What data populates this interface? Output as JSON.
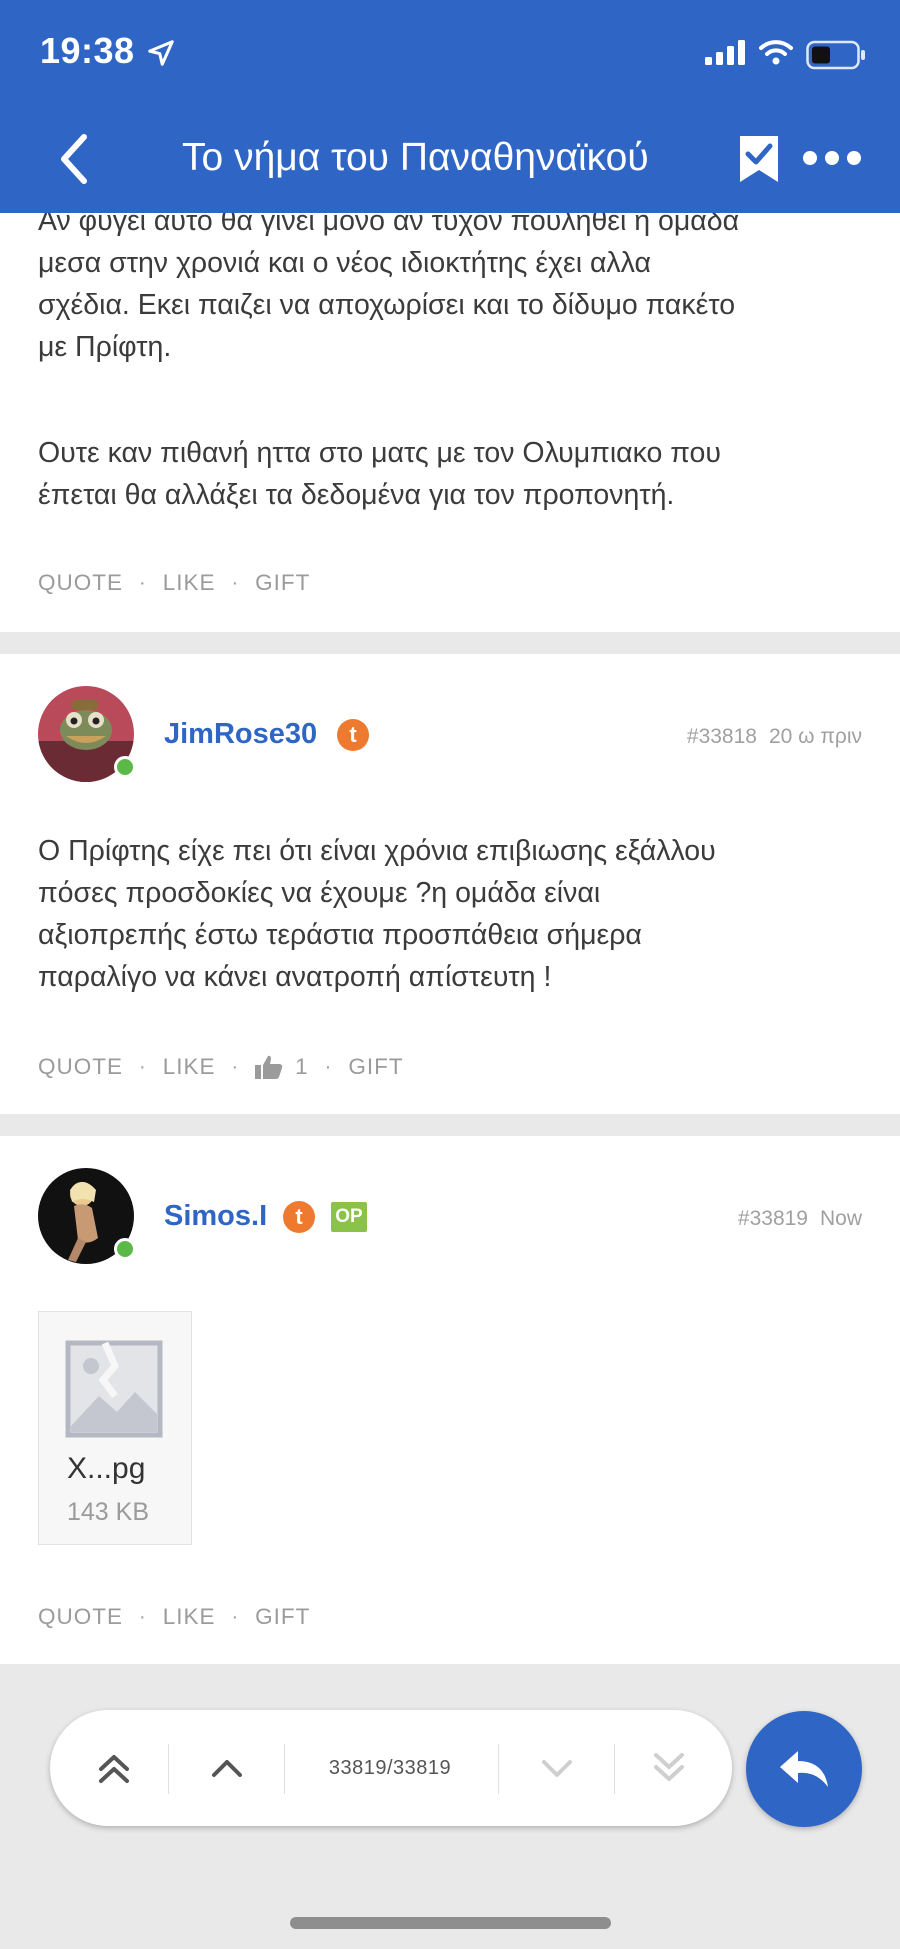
{
  "status_bar": {
    "time": "19:38"
  },
  "nav": {
    "title": "Το νήμα του Παναθηναϊκού"
  },
  "posts": [
    {
      "lines": [
        "Αν φυγει αυτο θα γινει μονο αν τυχον πουληθει η ομαδα",
        "μεσα στην χρονιά και ο νέος ιδιοκτήτης έχει αλλα",
        "σχέδια. Εκει παιζει να αποχωρίσει και το δίδυμο πακέτο",
        "με Πρίφτη.",
        "Ουτε καν πιθανή ηττα στο ματς με τον Ολυμπιακο που",
        "έπεται θα αλλάξει τα δεδομένα για τον προπονητή."
      ],
      "actions": {
        "quote": "QUOTE",
        "like": "LIKE",
        "gift": "GIFT"
      }
    },
    {
      "username": "JimRose30",
      "badge": "t",
      "post_number": "#33818",
      "time_ago": "20 ω πριν",
      "lines": [
        "Ο Πρίφτης είχε πει ότι είναι χρόνια επιβιωσης εξάλλου",
        "πόσες προσδοκίες να έχουμε ?η ομάδα είναι",
        "αξιοπρεπής έστω τεράστια προσπάθεια σήμερα",
        "παραλίγο να κάνει ανατροπή απίστευτη !"
      ],
      "actions": {
        "quote": "QUOTE",
        "like": "LIKE",
        "like_count": "1",
        "gift": "GIFT"
      }
    },
    {
      "username": "Simos.I",
      "badge": "t",
      "op_badge": "OP",
      "post_number": "#33819",
      "time_ago": "Now",
      "attachment": {
        "name": "X...pg",
        "size": "143 KB"
      },
      "actions": {
        "quote": "QUOTE",
        "like": "LIKE",
        "gift": "GIFT"
      }
    }
  ],
  "pager": {
    "position": "33819/33819"
  },
  "colors": {
    "brand": "#2f66c6",
    "online": "#5bb947",
    "badge_orange": "#ee7a2f",
    "op_green": "#8bc34a"
  }
}
